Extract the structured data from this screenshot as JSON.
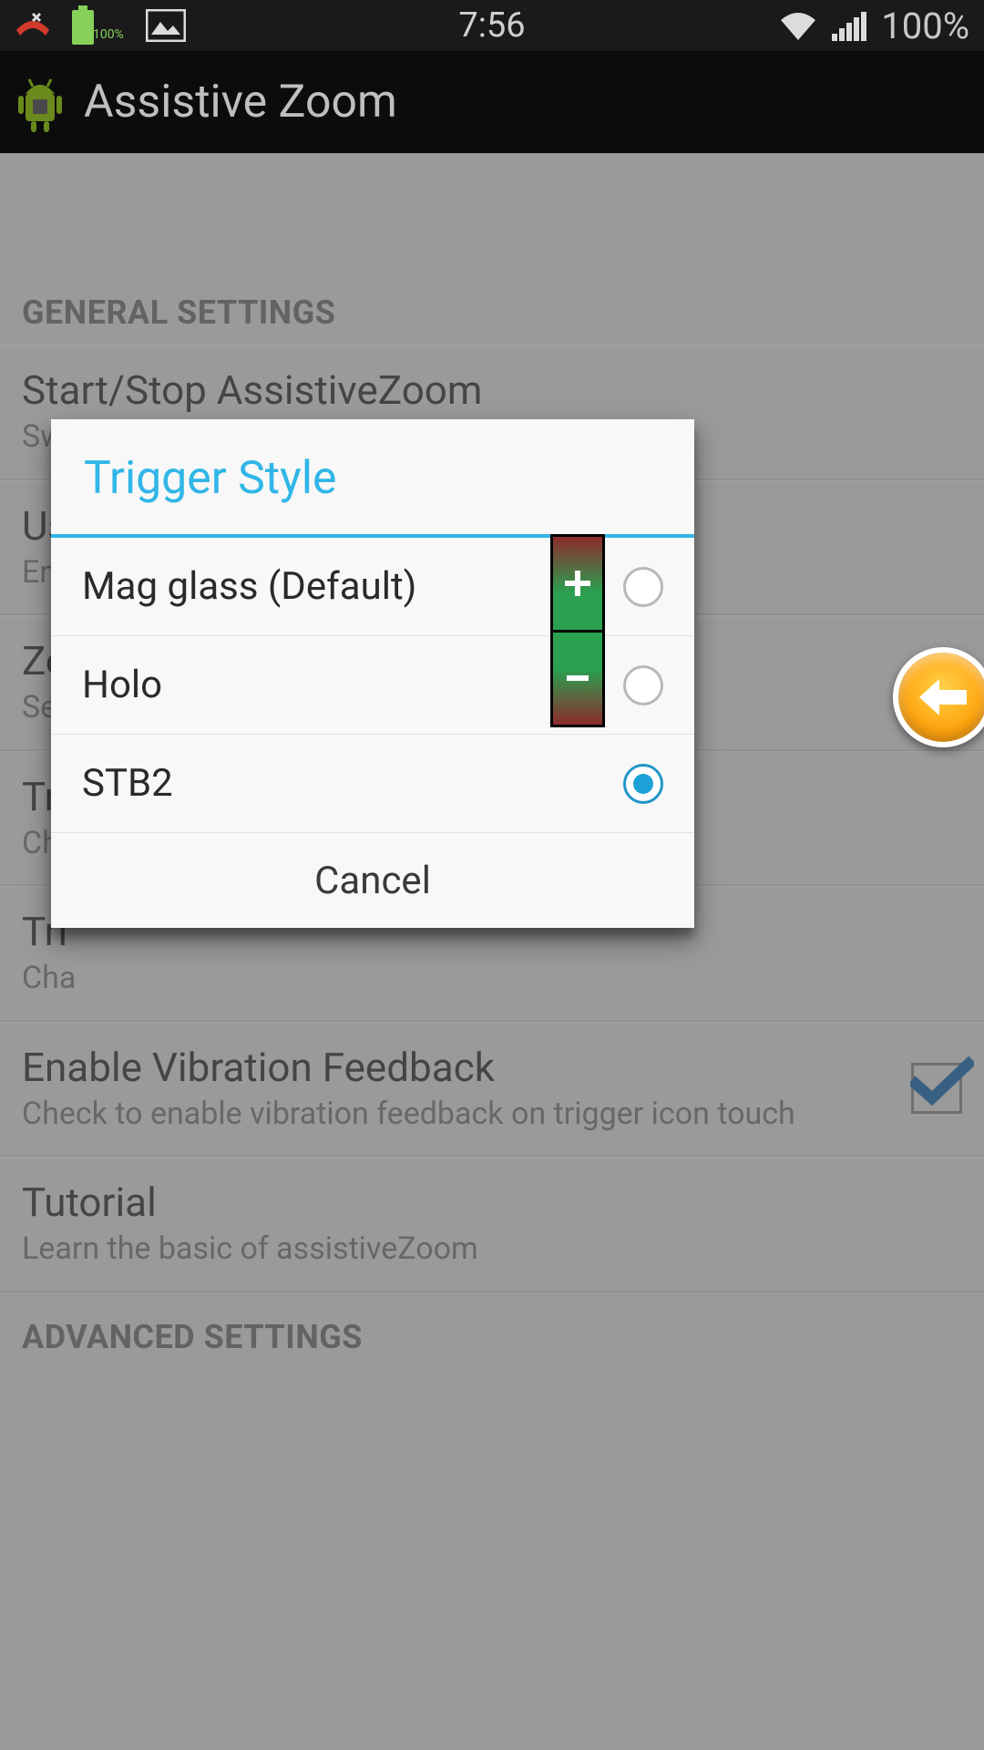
{
  "status_bar": {
    "time": "7:56",
    "battery_percent_label": "100%",
    "battery_badge": "100%"
  },
  "action_bar": {
    "title": "Assistive Zoom"
  },
  "sections": {
    "general_header": "GENERAL SETTINGS",
    "advanced_header": "ADVANCED SETTINGS"
  },
  "items": {
    "start_stop": {
      "title": "Start/Stop AssistiveZoom",
      "subtitle": "Switch off/on AssistiveZoom service"
    },
    "use": {
      "title_fragment": "Us",
      "subtitle_fragment": "Ena"
    },
    "zoom": {
      "title_fragment": "Zo",
      "subtitle_fragment": "Set"
    },
    "trigger_style_row": {
      "title_fragment": "Tri",
      "subtitle_fragment": "Cho"
    },
    "trigger_other_row": {
      "title_fragment": "Tri",
      "subtitle_fragment": "Cha"
    },
    "vibration": {
      "title": "Enable Vibration Feedback",
      "subtitle": "Check to enable vibration feedback on trigger icon touch",
      "checked": true
    },
    "tutorial": {
      "title": "Tutorial",
      "subtitle": "Learn the basic of assistiveZoom"
    }
  },
  "dialog": {
    "title": "Trigger Style",
    "options": [
      {
        "label": "Mag glass (Default)",
        "selected": false
      },
      {
        "label": "Holo",
        "selected": false
      },
      {
        "label": "STB2",
        "selected": true
      }
    ],
    "cancel": "Cancel"
  },
  "icons": {
    "missed_call": "missed-call-icon",
    "battery": "battery-full-icon",
    "picture": "picture-icon",
    "wifi": "wifi-icon",
    "signal": "signal-icon",
    "android": "android-robot-icon",
    "back_arrow": "back-arrow-icon",
    "plus": "plus-icon",
    "minus": "minus-icon",
    "check": "check-icon"
  }
}
